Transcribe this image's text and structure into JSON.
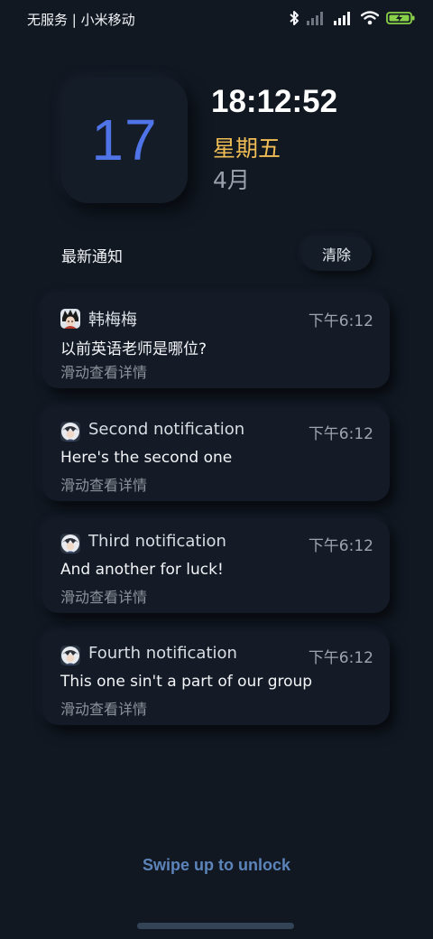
{
  "status_bar": {
    "carrier": "无服务 | 小米移动",
    "icons": [
      "bluetooth-icon",
      "signal-weak-icon",
      "signal-strong-icon",
      "wifi-icon",
      "battery-charging-icon"
    ]
  },
  "lock_screen": {
    "date_number": "17",
    "time": "18:12:52",
    "weekday": "星期五",
    "month": "4月",
    "accent_date_color": "#4f74e8",
    "accent_weekday_color": "#f0bd55"
  },
  "notifications": {
    "title": "最新通知",
    "clear_label": "清除",
    "items": [
      {
        "sender": "韩梅梅",
        "time": "下午6:12",
        "message": "以前英语老师是哪位?",
        "hint": "滑动查看详情",
        "avatar": "anime-boy-avatar"
      },
      {
        "sender": "Second notification",
        "time": "下午6:12",
        "message": "Here's the second one",
        "hint": "滑动查看详情",
        "avatar": "anime-character-avatar"
      },
      {
        "sender": "Third notification",
        "time": "下午6:12",
        "message": "And another for luck!",
        "hint": "滑动查看详情",
        "avatar": "anime-character-avatar"
      },
      {
        "sender": "Fourth notification",
        "time": "下午6:12",
        "message": "This one sin't a part of our group",
        "hint": "滑动查看详情",
        "avatar": "anime-character-avatar"
      }
    ]
  },
  "unlock": {
    "label": "Swipe up to unlock"
  }
}
